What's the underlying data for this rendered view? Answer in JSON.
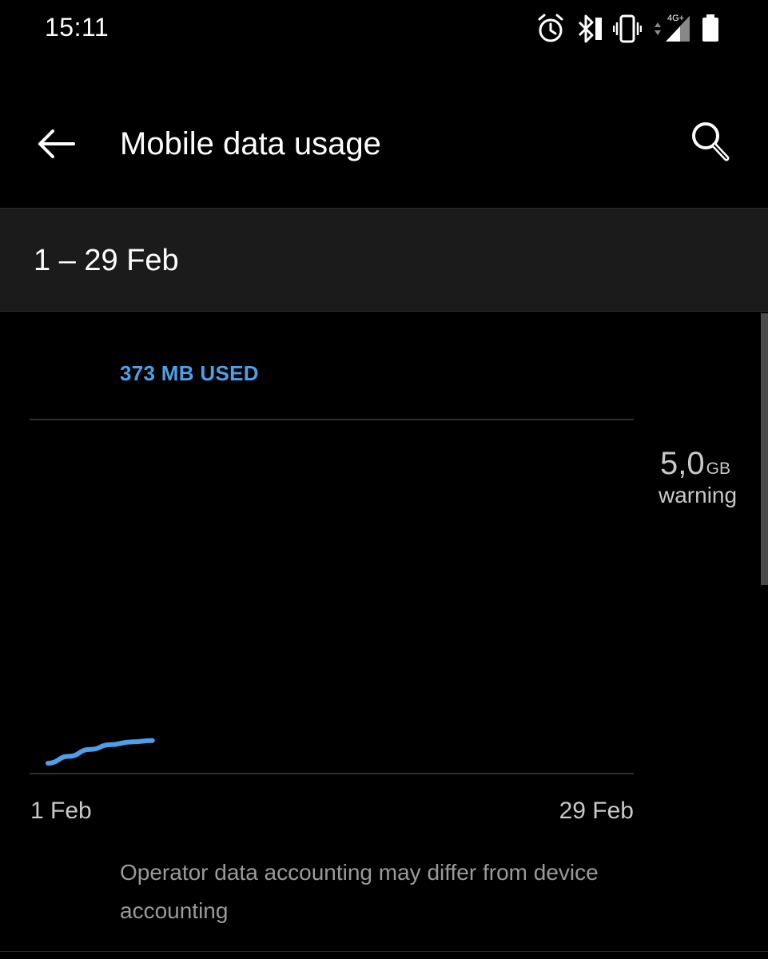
{
  "status_bar": {
    "time": "15:11",
    "network": "4G+",
    "icons": [
      "alarm-icon",
      "bluetooth-icon",
      "vibrate-icon",
      "signal-icon",
      "battery-icon"
    ]
  },
  "app_bar": {
    "title": "Mobile data usage",
    "back_icon": "arrow-left-icon",
    "search_icon": "search-icon"
  },
  "period": {
    "label": "1 – 29 Feb"
  },
  "usage": {
    "label": "373 MB USED",
    "color": "#4d9fe8"
  },
  "chart_data": {
    "type": "line",
    "x_start_label": "1 Feb",
    "x_end_label": "29 Feb",
    "xlim": [
      1,
      29
    ],
    "ylim": [
      0,
      5.0
    ],
    "y_unit": "GB",
    "limit_line": {
      "value": "5,0",
      "unit": "GB",
      "label": "warning"
    },
    "series": [
      {
        "color": "#4d9fe8",
        "x": [
          1,
          2,
          3,
          4,
          5,
          6
        ],
        "y": [
          0.0,
          0.1,
          0.2,
          0.27,
          0.31,
          0.33
        ]
      }
    ]
  },
  "footer": {
    "disclaimer": "Operator data accounting may differ from device accounting"
  }
}
